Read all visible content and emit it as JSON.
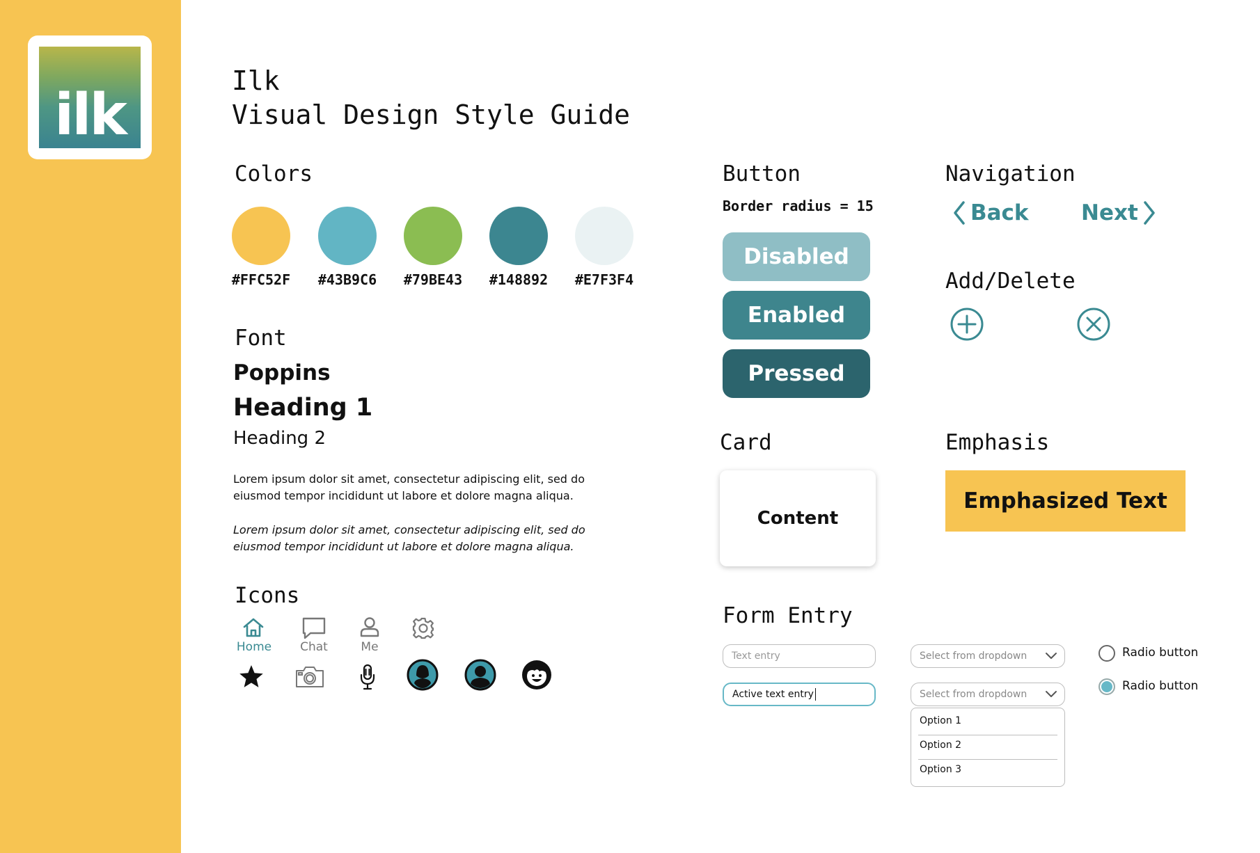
{
  "logo": {
    "text": "ilk"
  },
  "header": {
    "app_name": "Ilk",
    "title": "Visual Design Style Guide"
  },
  "colors": {
    "heading": "Colors",
    "swatches": [
      {
        "hex": "#FFC52F",
        "fill": "#F7C452"
      },
      {
        "hex": "#43B9C6",
        "fill": "#62B5C4"
      },
      {
        "hex": "#79BE43",
        "fill": "#8BBD52"
      },
      {
        "hex": "#148892",
        "fill": "#3C8690"
      },
      {
        "hex": "#E7F3F4",
        "fill": "#EAF2F3"
      }
    ]
  },
  "font": {
    "heading": "Font",
    "family_name": "Poppins",
    "heading1": "Heading 1",
    "heading2": "Heading 2",
    "para_regular": "Lorem ipsum dolor sit amet, consectetur adipiscing elit, sed do eiusmod tempor incididunt ut labore et dolore magna aliqua.",
    "para_italic": "Lorem ipsum dolor sit amet, consectetur adipiscing elit, sed do eiusmod tempor incididunt ut labore et dolore magna aliqua."
  },
  "icons": {
    "heading": "Icons",
    "nav_items": [
      {
        "label": "Home",
        "icon": "home-icon",
        "color": "#3A8A92"
      },
      {
        "label": "Chat",
        "icon": "chat-icon",
        "color": "#777777"
      },
      {
        "label": "Me",
        "icon": "person-icon",
        "color": "#777777"
      }
    ],
    "other": [
      "gear-icon",
      "star-icon",
      "camera-icon",
      "microphone-icon",
      "avatar-female-icon",
      "avatar-male-icon",
      "avatar-child-icon"
    ]
  },
  "button": {
    "heading": "Button",
    "radius_note": "Border radius = 15",
    "states": [
      {
        "label": "Disabled",
        "bg": "#8FBEC5"
      },
      {
        "label": "Enabled",
        "bg": "#3E858D"
      },
      {
        "label": "Pressed",
        "bg": "#2C646D"
      }
    ]
  },
  "navigation": {
    "heading": "Navigation",
    "back": "Back",
    "next": "Next",
    "color": "#3A8A92"
  },
  "add_delete": {
    "heading": "Add/Delete"
  },
  "card": {
    "heading": "Card",
    "content": "Content"
  },
  "emphasis": {
    "heading": "Emphasis",
    "text": "Emphasized Text"
  },
  "form": {
    "heading": "Form Entry",
    "text_placeholder": "Text entry",
    "active_value": "Active text entry",
    "select_placeholder_1": "Select from dropdown",
    "select_placeholder_2": "Select from dropdown",
    "options": [
      "Option 1",
      "Option 2",
      "Option 3"
    ],
    "radio_1": "Radio button",
    "radio_2": "Radio button",
    "accent": "#67B8C7"
  }
}
